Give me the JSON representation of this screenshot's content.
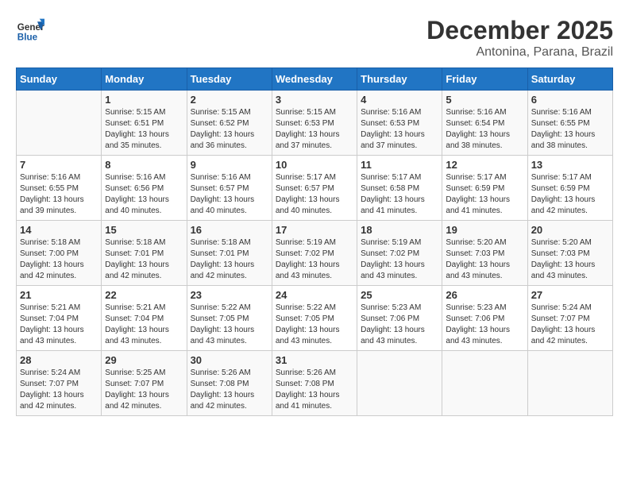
{
  "header": {
    "logo_general": "General",
    "logo_blue": "Blue",
    "month": "December 2025",
    "location": "Antonina, Parana, Brazil"
  },
  "days_of_week": [
    "Sunday",
    "Monday",
    "Tuesday",
    "Wednesday",
    "Thursday",
    "Friday",
    "Saturday"
  ],
  "weeks": [
    [
      {
        "day": "",
        "sunrise": "",
        "sunset": "",
        "daylight": ""
      },
      {
        "day": "1",
        "sunrise": "Sunrise: 5:15 AM",
        "sunset": "Sunset: 6:51 PM",
        "daylight": "Daylight: 13 hours and 35 minutes."
      },
      {
        "day": "2",
        "sunrise": "Sunrise: 5:15 AM",
        "sunset": "Sunset: 6:52 PM",
        "daylight": "Daylight: 13 hours and 36 minutes."
      },
      {
        "day": "3",
        "sunrise": "Sunrise: 5:15 AM",
        "sunset": "Sunset: 6:53 PM",
        "daylight": "Daylight: 13 hours and 37 minutes."
      },
      {
        "day": "4",
        "sunrise": "Sunrise: 5:16 AM",
        "sunset": "Sunset: 6:53 PM",
        "daylight": "Daylight: 13 hours and 37 minutes."
      },
      {
        "day": "5",
        "sunrise": "Sunrise: 5:16 AM",
        "sunset": "Sunset: 6:54 PM",
        "daylight": "Daylight: 13 hours and 38 minutes."
      },
      {
        "day": "6",
        "sunrise": "Sunrise: 5:16 AM",
        "sunset": "Sunset: 6:55 PM",
        "daylight": "Daylight: 13 hours and 38 minutes."
      }
    ],
    [
      {
        "day": "7",
        "sunrise": "Sunrise: 5:16 AM",
        "sunset": "Sunset: 6:55 PM",
        "daylight": "Daylight: 13 hours and 39 minutes."
      },
      {
        "day": "8",
        "sunrise": "Sunrise: 5:16 AM",
        "sunset": "Sunset: 6:56 PM",
        "daylight": "Daylight: 13 hours and 40 minutes."
      },
      {
        "day": "9",
        "sunrise": "Sunrise: 5:16 AM",
        "sunset": "Sunset: 6:57 PM",
        "daylight": "Daylight: 13 hours and 40 minutes."
      },
      {
        "day": "10",
        "sunrise": "Sunrise: 5:17 AM",
        "sunset": "Sunset: 6:57 PM",
        "daylight": "Daylight: 13 hours and 40 minutes."
      },
      {
        "day": "11",
        "sunrise": "Sunrise: 5:17 AM",
        "sunset": "Sunset: 6:58 PM",
        "daylight": "Daylight: 13 hours and 41 minutes."
      },
      {
        "day": "12",
        "sunrise": "Sunrise: 5:17 AM",
        "sunset": "Sunset: 6:59 PM",
        "daylight": "Daylight: 13 hours and 41 minutes."
      },
      {
        "day": "13",
        "sunrise": "Sunrise: 5:17 AM",
        "sunset": "Sunset: 6:59 PM",
        "daylight": "Daylight: 13 hours and 42 minutes."
      }
    ],
    [
      {
        "day": "14",
        "sunrise": "Sunrise: 5:18 AM",
        "sunset": "Sunset: 7:00 PM",
        "daylight": "Daylight: 13 hours and 42 minutes."
      },
      {
        "day": "15",
        "sunrise": "Sunrise: 5:18 AM",
        "sunset": "Sunset: 7:01 PM",
        "daylight": "Daylight: 13 hours and 42 minutes."
      },
      {
        "day": "16",
        "sunrise": "Sunrise: 5:18 AM",
        "sunset": "Sunset: 7:01 PM",
        "daylight": "Daylight: 13 hours and 42 minutes."
      },
      {
        "day": "17",
        "sunrise": "Sunrise: 5:19 AM",
        "sunset": "Sunset: 7:02 PM",
        "daylight": "Daylight: 13 hours and 43 minutes."
      },
      {
        "day": "18",
        "sunrise": "Sunrise: 5:19 AM",
        "sunset": "Sunset: 7:02 PM",
        "daylight": "Daylight: 13 hours and 43 minutes."
      },
      {
        "day": "19",
        "sunrise": "Sunrise: 5:20 AM",
        "sunset": "Sunset: 7:03 PM",
        "daylight": "Daylight: 13 hours and 43 minutes."
      },
      {
        "day": "20",
        "sunrise": "Sunrise: 5:20 AM",
        "sunset": "Sunset: 7:03 PM",
        "daylight": "Daylight: 13 hours and 43 minutes."
      }
    ],
    [
      {
        "day": "21",
        "sunrise": "Sunrise: 5:21 AM",
        "sunset": "Sunset: 7:04 PM",
        "daylight": "Daylight: 13 hours and 43 minutes."
      },
      {
        "day": "22",
        "sunrise": "Sunrise: 5:21 AM",
        "sunset": "Sunset: 7:04 PM",
        "daylight": "Daylight: 13 hours and 43 minutes."
      },
      {
        "day": "23",
        "sunrise": "Sunrise: 5:22 AM",
        "sunset": "Sunset: 7:05 PM",
        "daylight": "Daylight: 13 hours and 43 minutes."
      },
      {
        "day": "24",
        "sunrise": "Sunrise: 5:22 AM",
        "sunset": "Sunset: 7:05 PM",
        "daylight": "Daylight: 13 hours and 43 minutes."
      },
      {
        "day": "25",
        "sunrise": "Sunrise: 5:23 AM",
        "sunset": "Sunset: 7:06 PM",
        "daylight": "Daylight: 13 hours and 43 minutes."
      },
      {
        "day": "26",
        "sunrise": "Sunrise: 5:23 AM",
        "sunset": "Sunset: 7:06 PM",
        "daylight": "Daylight: 13 hours and 43 minutes."
      },
      {
        "day": "27",
        "sunrise": "Sunrise: 5:24 AM",
        "sunset": "Sunset: 7:07 PM",
        "daylight": "Daylight: 13 hours and 42 minutes."
      }
    ],
    [
      {
        "day": "28",
        "sunrise": "Sunrise: 5:24 AM",
        "sunset": "Sunset: 7:07 PM",
        "daylight": "Daylight: 13 hours and 42 minutes."
      },
      {
        "day": "29",
        "sunrise": "Sunrise: 5:25 AM",
        "sunset": "Sunset: 7:07 PM",
        "daylight": "Daylight: 13 hours and 42 minutes."
      },
      {
        "day": "30",
        "sunrise": "Sunrise: 5:26 AM",
        "sunset": "Sunset: 7:08 PM",
        "daylight": "Daylight: 13 hours and 42 minutes."
      },
      {
        "day": "31",
        "sunrise": "Sunrise: 5:26 AM",
        "sunset": "Sunset: 7:08 PM",
        "daylight": "Daylight: 13 hours and 41 minutes."
      },
      {
        "day": "",
        "sunrise": "",
        "sunset": "",
        "daylight": ""
      },
      {
        "day": "",
        "sunrise": "",
        "sunset": "",
        "daylight": ""
      },
      {
        "day": "",
        "sunrise": "",
        "sunset": "",
        "daylight": ""
      }
    ]
  ]
}
